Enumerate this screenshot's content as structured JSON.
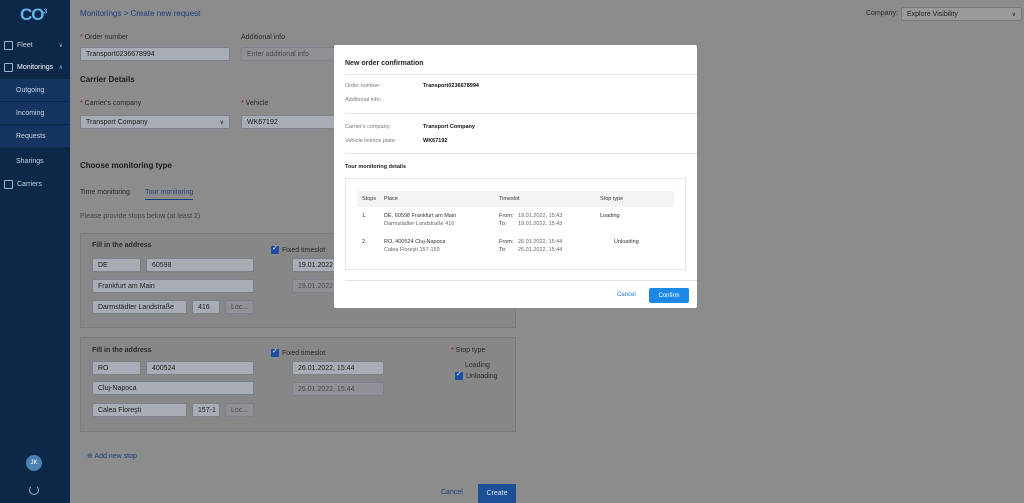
{
  "sidebar": {
    "logo": "CO",
    "logo_sup": "3",
    "items": [
      {
        "label": "Fleet",
        "icon": "truck-icon"
      },
      {
        "label": "Monitorings",
        "icon": "monitor-icon"
      },
      {
        "label": "Carriers",
        "icon": "document-icon"
      }
    ],
    "sub_items": [
      "Outgoing",
      "Incoming",
      "Requests",
      "Sharings"
    ],
    "avatar": "JK"
  },
  "header": {
    "breadcrumb": "Monitorings > Create new request",
    "company_label": "Company:",
    "company_value": "Explore Visibility"
  },
  "form": {
    "order_number_label": "Order number",
    "order_number_value": "Transport0236678994",
    "additional_info_label": "Additional info",
    "additional_info_placeholder": "Enter additional info",
    "carrier_details": "Carrier Details",
    "carrier_company_label": "Carrier's company",
    "carrier_company_value": "Transport Company",
    "vehicle_label": "Vehicle",
    "vehicle_value": "WK67192",
    "monitoring_type": "Choose monitoring type",
    "tab_time": "Time monitoring",
    "tab_tour": "Tour monitoring",
    "stops_hint": "Please provide stops below (at least 2)",
    "fill_address": "Fill in the address",
    "fixed_timeslot": "Fixed timeslot",
    "stop_type": "Stop type",
    "loading": "Loading",
    "unloading": "Unloading",
    "stop1": {
      "country": "DE",
      "zip": "60598",
      "city": "Frankfurt am Main",
      "street": "Darmstädter Landstraße",
      "number": "416",
      "loc": "Loc...",
      "from": "19.01.2022",
      "to": "19.01.2022"
    },
    "stop2": {
      "country": "RO",
      "zip": "400524",
      "city": "Cluj-Napoca",
      "street": "Calea Floreşti",
      "number": "157-1",
      "loc": "Loc...",
      "from": "26.01.2022, 15:44",
      "to": "26.01.2022, 15:44"
    },
    "add_stop": "Add new stop",
    "cancel": "Cancel",
    "create": "Create"
  },
  "modal": {
    "title": "New order confirmation",
    "order_number_key": "Order number:",
    "order_number_val": "Transport0236678994",
    "additional_info_key": "Additional info:",
    "carrier_company_key": "Carrier's company:",
    "carrier_company_val": "Transport Company",
    "plate_key": "Vehicle licence plate:",
    "plate_val": "WK67192",
    "tour_details": "Tour monitoring details",
    "cols": [
      "Stops",
      "Place",
      "Timeslot",
      "Stop type"
    ],
    "rows": [
      {
        "stop": "1.",
        "place1": "DE, 60598 Frankfurt am Main",
        "place2": "Darmstädter Landstraße 416",
        "from_key": "From:",
        "from": "19.01.2022, 15:43",
        "to_key": "To:",
        "to": "19.01.2022, 15:43",
        "type": "Loading"
      },
      {
        "stop": "2.",
        "place1": "RO, 400524 Cluj-Napoca",
        "place2": "Calea Floreşti 157-159",
        "from_key": "From:",
        "from": "26.01.2022, 15:44",
        "to_key": "To:",
        "to": "26.01.2022, 15:44",
        "type": "Unloading"
      }
    ],
    "cancel": "Cancel",
    "confirm": "Confirm"
  }
}
